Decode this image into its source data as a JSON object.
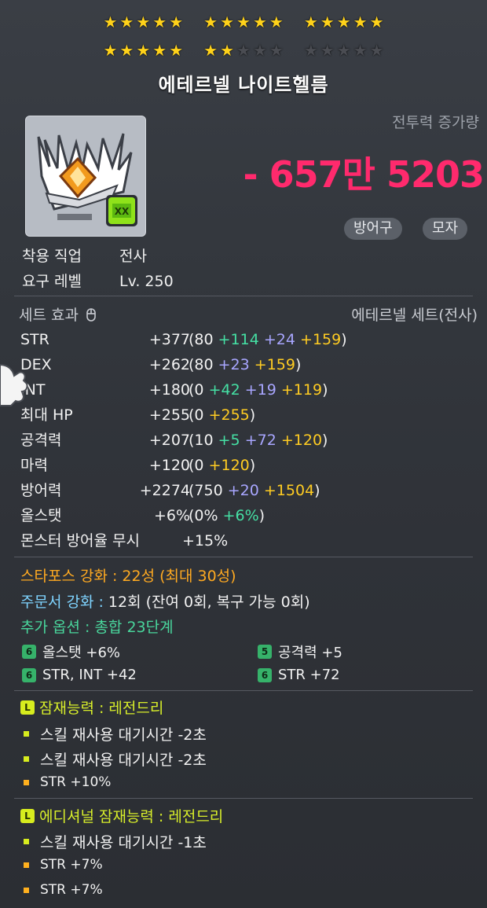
{
  "stars": {
    "groups": [
      [
        "★",
        "★",
        "★",
        "★",
        "★"
      ],
      [
        "★",
        "★",
        "★",
        "★",
        "★"
      ],
      [
        "★",
        "★",
        "★",
        "★",
        "★"
      ],
      [
        "★",
        "★",
        "★",
        "★",
        "★"
      ],
      [
        "★",
        "★",
        "★",
        "★",
        "★"
      ],
      [
        "★",
        "★",
        "★",
        "★",
        "★"
      ]
    ],
    "filled": 22,
    "max": 30
  },
  "item": {
    "name": "에테르넬 나이트헬름",
    "icon": "helmet-icon",
    "power_label": "전투력 증가량",
    "power_value": "- 657만 5203",
    "tags": [
      "방어구",
      "모자"
    ],
    "job_label": "착용 직업",
    "job_value": "전사",
    "level_label": "요구 레벨",
    "level_value": "Lv. 250"
  },
  "set": {
    "label": "세트 효과",
    "name": "에테르넬 세트(전사)"
  },
  "stats": [
    {
      "name": "STR",
      "total": "+377",
      "base": "(80",
      "g": "+114",
      "b": "+24",
      "y": "+159",
      "close": ")"
    },
    {
      "name": "DEX",
      "total": "+262",
      "base": "(80",
      "g": "",
      "b": "+23",
      "y": "+159",
      "close": ")"
    },
    {
      "name": "INT",
      "total": "+180",
      "base": "(0",
      "g": "+42",
      "b": "+19",
      "y": "+119",
      "close": ")"
    },
    {
      "name": "최대 HP",
      "total": "+255",
      "base": "(0",
      "g": "",
      "b": "",
      "y": "+255",
      "close": ")"
    },
    {
      "name": "공격력",
      "total": "+207",
      "base": "(10",
      "g": "+5",
      "b": "+72",
      "y": "+120",
      "close": ")"
    },
    {
      "name": "마력",
      "total": "+120",
      "base": "(0",
      "g": "",
      "b": "",
      "y": "+120",
      "close": ")"
    },
    {
      "name": "방어력",
      "total": "+2274",
      "base": "(750",
      "g": "",
      "b": "+20",
      "y": "+1504",
      "close": ")"
    },
    {
      "name": "올스탯",
      "total": "+6%",
      "base": "(0%",
      "g": "+6%",
      "b": "",
      "y": "",
      "close": ")"
    },
    {
      "name": "몬스터 방어율 무시",
      "total": "+15%",
      "base": "",
      "g": "",
      "b": "",
      "y": "",
      "close": ""
    }
  ],
  "enhance": {
    "starforce": "스타포스 강화 : 22성 (최대 30성)",
    "scroll_label": "주문서 강화 : ",
    "scroll_value": "12회 (잔여 0회, 복구 가능 0회)",
    "extra": "추가 옵션 : 총합 23단계"
  },
  "extra_options": [
    {
      "grade": "6",
      "text": "올스탯  +6%"
    },
    {
      "grade": "5",
      "text": "공격력  +5"
    },
    {
      "grade": "6",
      "text": "STR, INT  +42"
    },
    {
      "grade": "6",
      "text": "STR  +72"
    }
  ],
  "potential": {
    "badge": "L",
    "title": "잠재능력 : 레전드리",
    "lines": [
      "스킬 재사용 대기시간 -2초",
      "스킬 재사용 대기시간 -2초",
      "STR +10%"
    ]
  },
  "additional": {
    "badge": "L",
    "title": "에디셔널 잠재능력 : 레전드리",
    "lines": [
      "스킬 재사용 대기시간 -1초",
      "STR +7%",
      "STR +7%"
    ]
  },
  "colors": {
    "accent": "#ff2a6d",
    "star": "#ffd21a",
    "legendary": "#d7ec1e",
    "starforce": "#ffaa21"
  }
}
